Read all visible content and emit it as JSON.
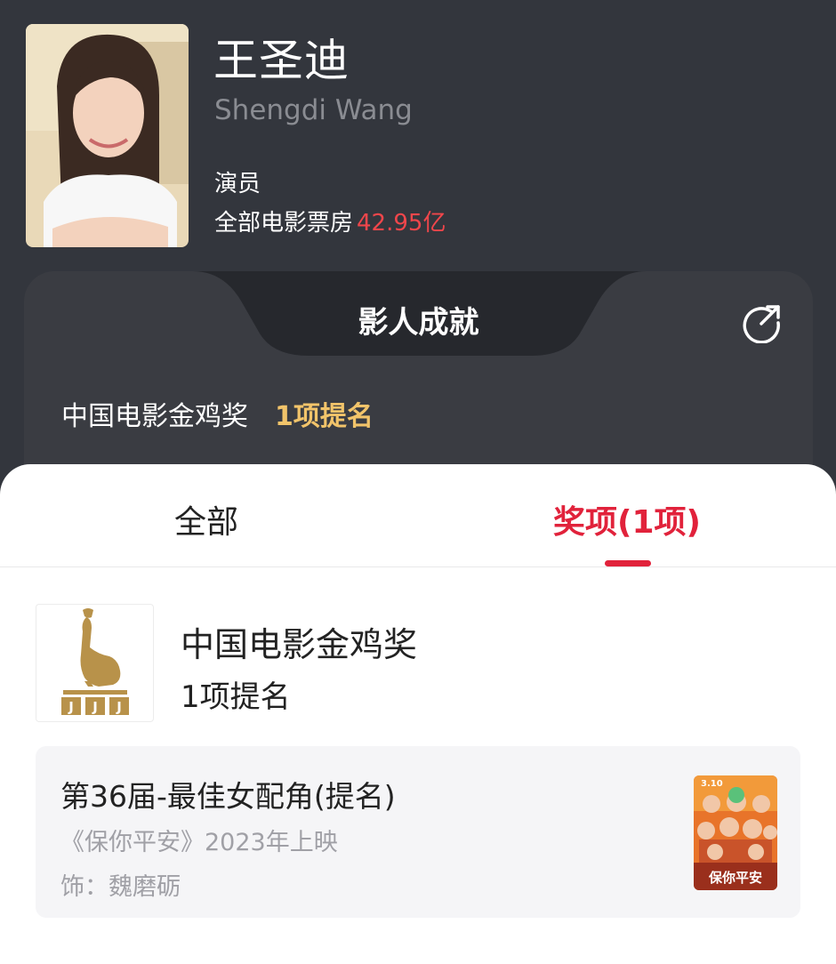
{
  "profile": {
    "name_cn": "王圣迪",
    "name_en": "Shengdi Wang",
    "role": "演员",
    "boxoffice_label": "全部电影票房",
    "boxoffice_value": "42.95亿"
  },
  "achievements": {
    "title": "影人成就",
    "items": [
      {
        "award": "中国电影金鸡奖",
        "count": "1项提名"
      }
    ]
  },
  "tabs": [
    {
      "label": "全部",
      "active": false
    },
    {
      "label": "奖项(1项)",
      "active": true
    }
  ],
  "award": {
    "name": "中国电影金鸡奖",
    "count": "1项提名",
    "logo_text": "JJJ"
  },
  "nomination": {
    "title": "第36届-最佳女配角(提名)",
    "film": "《保你平安》2023年上映",
    "role": "饰：魏磨砺",
    "poster_date": "3.10",
    "poster_title": "保你平安"
  },
  "colors": {
    "accent_red": "#e1223b",
    "boxoffice_red": "#f0464b",
    "gold": "#f2c46a"
  }
}
